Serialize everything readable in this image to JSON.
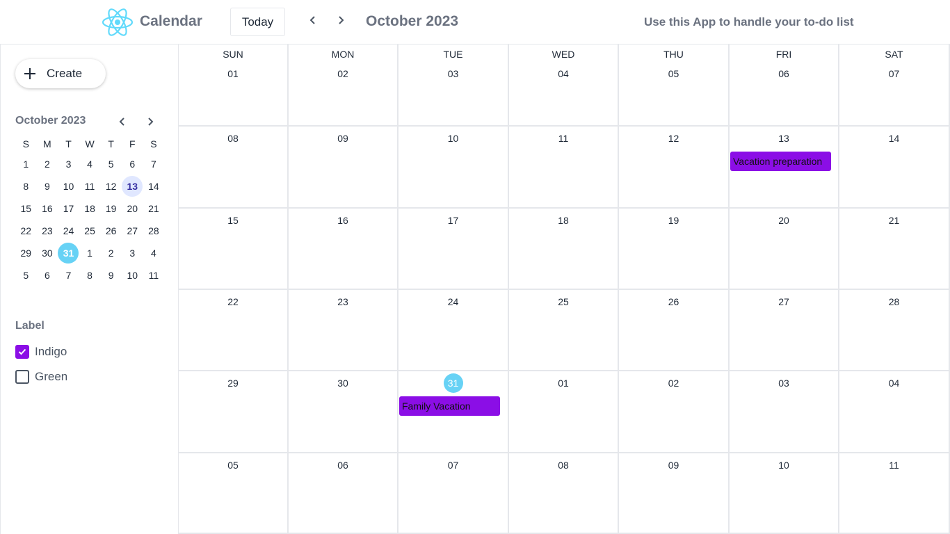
{
  "header": {
    "app_title": "Calendar",
    "today_label": "Today",
    "month_title": "October 2023",
    "tagline": "Use this App to handle your to-do list",
    "logo_icon": "react-atom-logo",
    "accent_color": "#61dafb"
  },
  "sidebar": {
    "create_label": "Create",
    "mini_calendar": {
      "title": "October 2023",
      "weekday_initials": [
        "S",
        "M",
        "T",
        "W",
        "T",
        "F",
        "S"
      ],
      "weeks": [
        [
          "1",
          "2",
          "3",
          "4",
          "5",
          "6",
          "7"
        ],
        [
          "8",
          "9",
          "10",
          "11",
          "12",
          "13",
          "14"
        ],
        [
          "15",
          "16",
          "17",
          "18",
          "19",
          "20",
          "21"
        ],
        [
          "22",
          "23",
          "24",
          "25",
          "26",
          "27",
          "28"
        ],
        [
          "29",
          "30",
          "31",
          "1",
          "2",
          "3",
          "4"
        ],
        [
          "5",
          "6",
          "7",
          "8",
          "9",
          "10",
          "11"
        ]
      ],
      "selected_day": "13",
      "today": "31"
    },
    "label_title": "Label",
    "labels": [
      {
        "name": "Indigo",
        "checked": true,
        "color": "#8b0ee6"
      },
      {
        "name": "Green",
        "checked": false,
        "color": "#4b5563"
      }
    ]
  },
  "month_grid": {
    "weekday_headers": [
      "SUN",
      "MON",
      "TUE",
      "WED",
      "THU",
      "FRI",
      "SAT"
    ],
    "weeks": [
      [
        "01",
        "02",
        "03",
        "04",
        "05",
        "06",
        "07"
      ],
      [
        "08",
        "09",
        "10",
        "11",
        "12",
        "13",
        "14"
      ],
      [
        "15",
        "16",
        "17",
        "18",
        "19",
        "20",
        "21"
      ],
      [
        "22",
        "23",
        "24",
        "25",
        "26",
        "27",
        "28"
      ],
      [
        "29",
        "30",
        "31",
        "01",
        "02",
        "03",
        "04"
      ],
      [
        "05",
        "06",
        "07",
        "08",
        "09",
        "10",
        "11"
      ]
    ],
    "today": {
      "week": 4,
      "day": 2
    },
    "events": [
      {
        "title": "Vacation preparation",
        "week": 1,
        "day": 5,
        "color": "#8b0ee6"
      },
      {
        "title": "Family Vacation",
        "week": 4,
        "day": 2,
        "color": "#8b0ee6"
      }
    ]
  }
}
